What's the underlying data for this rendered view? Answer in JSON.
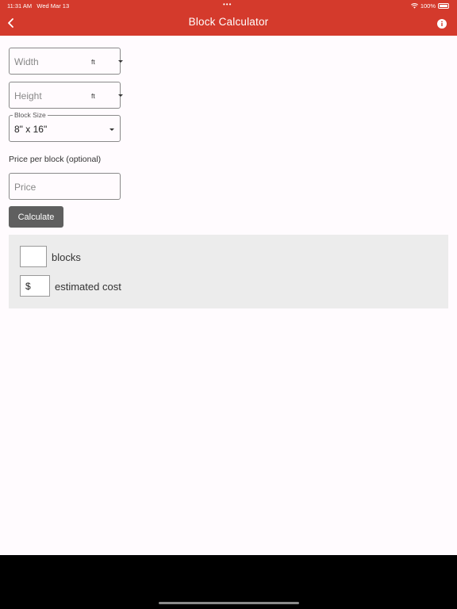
{
  "status": {
    "time": "11:31 AM",
    "date": "Wed Mar 13",
    "battery": "100%"
  },
  "header": {
    "title": "Block Calculator",
    "back_icon": "chevron-left-icon",
    "info_icon": "info-icon"
  },
  "form": {
    "width": {
      "placeholder": "Width",
      "unit": "ft"
    },
    "height": {
      "placeholder": "Height",
      "unit": "ft"
    },
    "block_size": {
      "label": "Block Size",
      "value": "8\" x 16\""
    },
    "price_label": "Price per block (optional)",
    "price": {
      "placeholder": "Price"
    },
    "calculate_label": "Calculate"
  },
  "results": {
    "blocks_label": "blocks",
    "cost_symbol": "$",
    "cost_label": "estimated cost"
  },
  "colors": {
    "header": "#d43a2c",
    "button": "#5f5f5f",
    "panel": "#ececec",
    "background": "#fffbfe"
  }
}
